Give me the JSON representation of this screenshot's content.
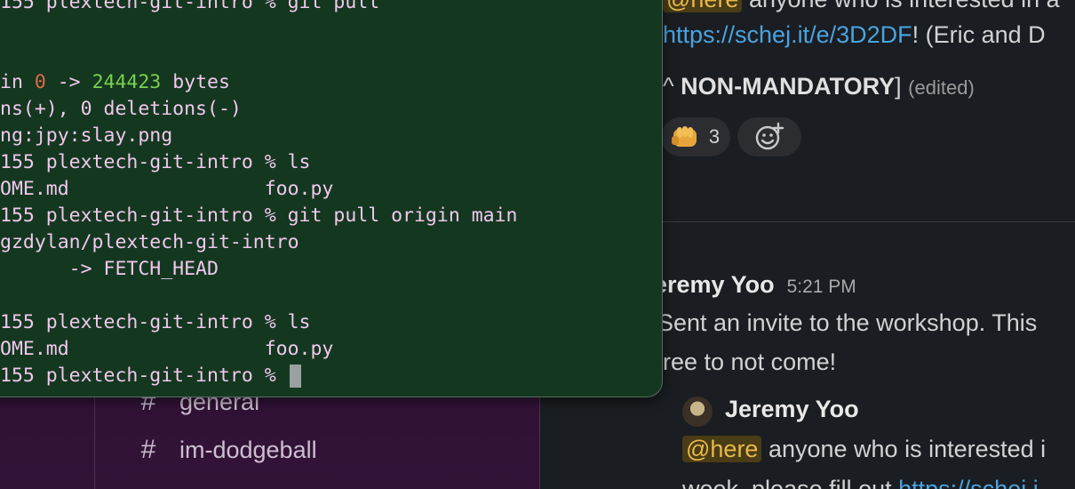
{
  "terminal": {
    "lines": [
      "155 plextech-git-intro % git pull",
      "",
      "",
      "in ",
      "ns(+), 0 deletions(-)",
      "ng:jpy:slay.png",
      "155 plextech-git-intro % ls",
      "OME.md                 foo.py",
      "155 plextech-git-intro % git pull origin main",
      "gzdylan/plextech-git-intro",
      "      -> FETCH_HEAD",
      "",
      "155 plextech-git-intro % ls",
      "OME.md                 foo.py",
      "155 plextech-git-intro % "
    ],
    "bytes_old": "0",
    "bytes_arrow": " -> ",
    "bytes_new": "244423",
    "bytes_unit": " bytes"
  },
  "sidebar": {
    "channels": [
      {
        "hash": "#",
        "name": "general"
      },
      {
        "hash": "#",
        "name": "im-dodgeball"
      }
    ]
  },
  "messages": {
    "top_mention": "@here",
    "top_text": " anyone who is interested in a",
    "link_line_link": "https://schej.it/e/3D2DF",
    "link_line_rest": "! (Eric and D",
    "nonmandatory_prefix": "^ ",
    "nonmandatory_strong": "NON-MANDATORY",
    "nonmandatory_suffix": "] ",
    "edited": "(edited)",
    "reaction_count": "3",
    "reaction_icon": "fist-bump-emoji",
    "add_reaction_icon": "add-reaction-icon",
    "post1_author": "eremy Yoo",
    "post1_time": "5:21 PM",
    "post1_line1": "Sent an invite to the workshop. This",
    "post1_line2": "ree to not come!",
    "post2_author": "Jeremy Yoo",
    "post2_mention": "@here",
    "post2_text": " anyone who is interested i",
    "post2_line2": "week, please fill out ",
    "post2_link": "https://schej.i"
  }
}
